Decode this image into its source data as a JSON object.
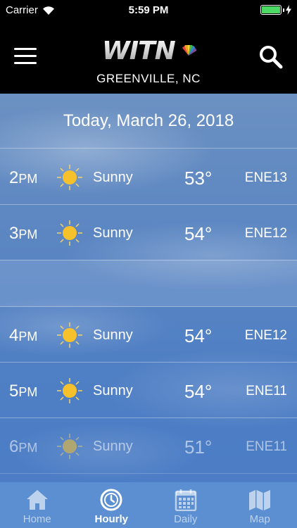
{
  "status_bar": {
    "carrier": "Carrier",
    "time": "5:59 PM"
  },
  "header": {
    "logo_text": "WITN",
    "location": "GREENVILLE, NC"
  },
  "forecast": {
    "date_label": "Today, March 26, 2018",
    "hours": [
      {
        "hour": "2",
        "period": "PM",
        "condition": "Sunny",
        "temp": "53°",
        "wind": "ENE13",
        "icon": "sun-icon"
      },
      {
        "hour": "3",
        "period": "PM",
        "condition": "Sunny",
        "temp": "54°",
        "wind": "ENE12",
        "icon": "sun-icon"
      },
      {
        "hour": "4",
        "period": "PM",
        "condition": "Sunny",
        "temp": "54°",
        "wind": "ENE12",
        "icon": "sun-icon"
      },
      {
        "hour": "5",
        "period": "PM",
        "condition": "Sunny",
        "temp": "54°",
        "wind": "ENE11",
        "icon": "sun-icon"
      },
      {
        "hour": "6",
        "period": "PM",
        "condition": "Sunny",
        "temp": "51°",
        "wind": "ENE11",
        "icon": "sun-icon"
      }
    ]
  },
  "tabs": [
    {
      "label": "Home",
      "icon": "home-icon",
      "active": false
    },
    {
      "label": "Hourly",
      "icon": "clock-icon",
      "active": true
    },
    {
      "label": "Daily",
      "icon": "calendar-icon",
      "active": false
    },
    {
      "label": "Map",
      "icon": "map-icon",
      "active": false
    }
  ],
  "colors": {
    "status_bar_bg": "#000000",
    "header_bg": "#000000",
    "battery": "#4cd964",
    "sun": "#f7c12b",
    "tab_bar_bg": "#5b8fd1"
  }
}
